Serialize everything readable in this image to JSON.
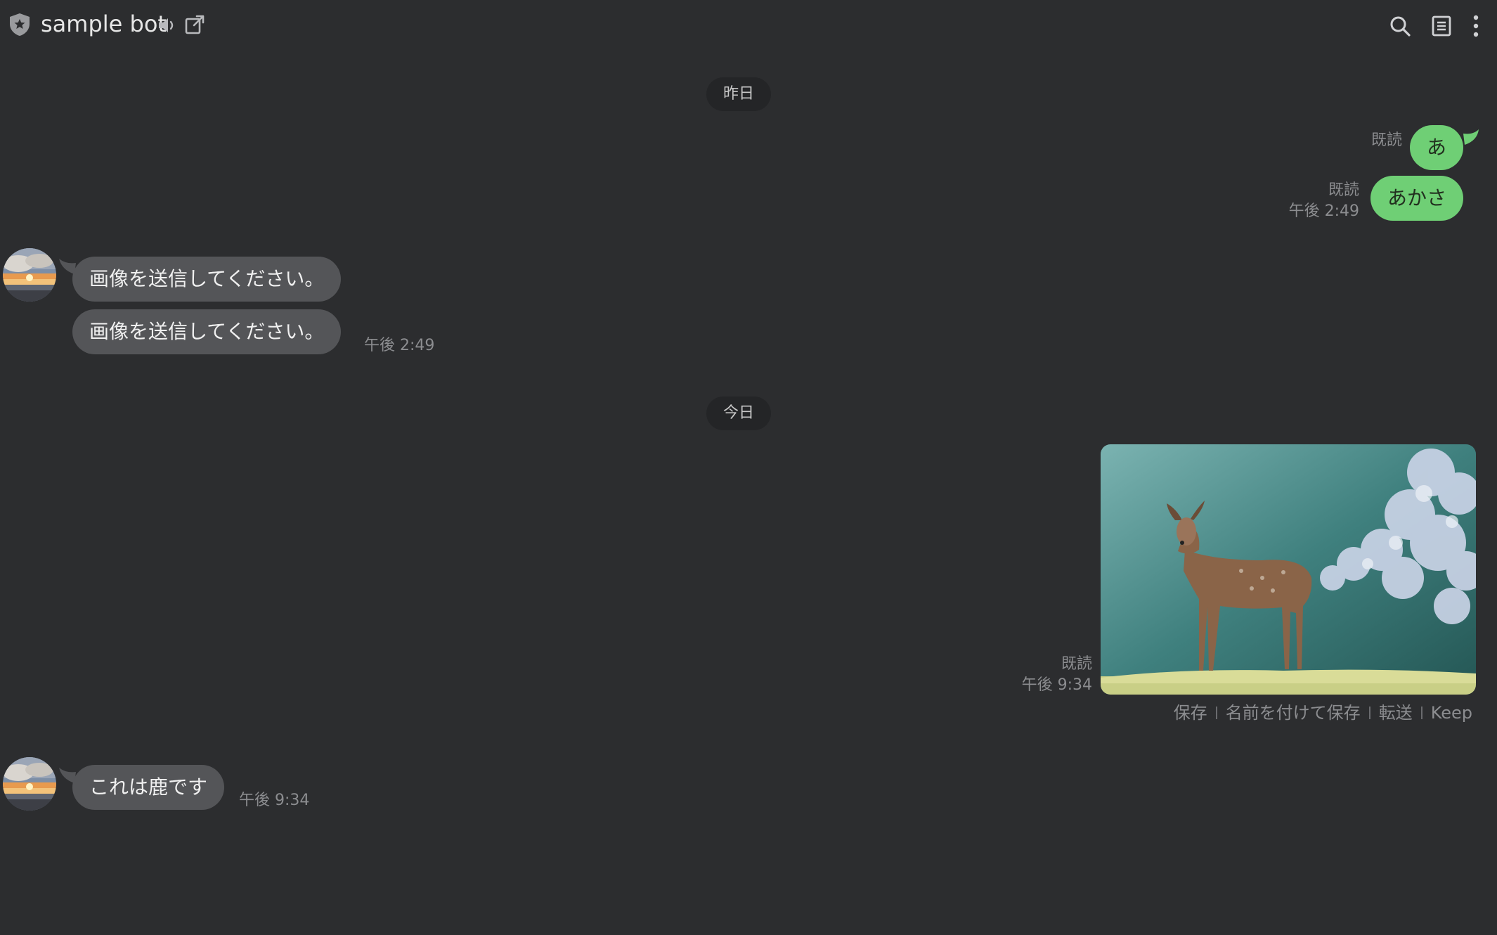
{
  "header": {
    "title": "sample bot",
    "icons": [
      "shield-icon",
      "speaker-icon",
      "external-link-icon",
      "search-icon",
      "notes-icon",
      "more-vertical-icon"
    ]
  },
  "dates": {
    "yesterday": "昨日",
    "today": "今日"
  },
  "messages": {
    "sent1": {
      "text": "あ",
      "read": "既読"
    },
    "sent2": {
      "text": "あかさ",
      "read": "既読",
      "time": "午後 2:49"
    },
    "recv1": {
      "text": "画像を送信してください。"
    },
    "recv2": {
      "text": "画像を送信してください。",
      "time": "午後 2:49"
    },
    "photo": {
      "read": "既読",
      "time": "午後 9:34"
    },
    "recv3": {
      "text": "これは鹿です",
      "time": "午後 9:34"
    }
  },
  "photo_actions": {
    "save": "保存",
    "save_as": "名前を付けて保存",
    "forward": "転送",
    "keep": "Keep"
  },
  "colors": {
    "background": "#2c2d2f",
    "sent_bubble": "#6fcf75",
    "recv_bubble": "#545558",
    "meta_text": "#8c8d90"
  }
}
